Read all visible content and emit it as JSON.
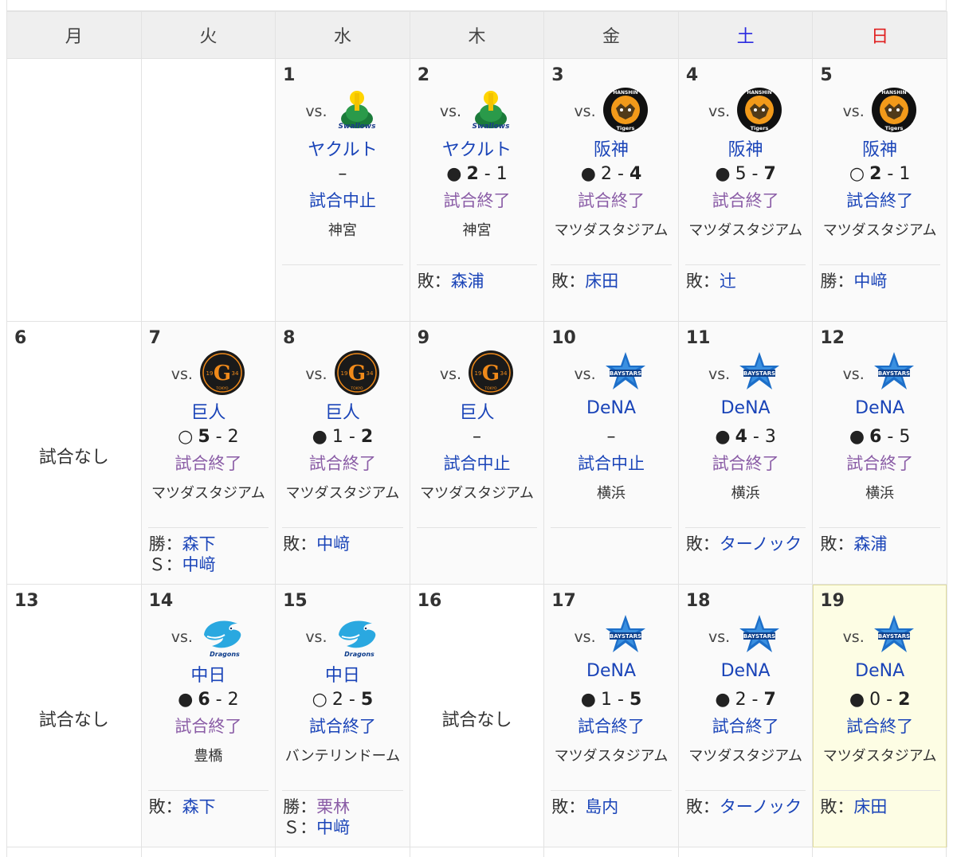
{
  "weekdays": [
    "月",
    "火",
    "水",
    "木",
    "金",
    "土",
    "日"
  ],
  "vs_label": "vs.",
  "no_game": "試合なし",
  "weeks": [
    [
      {
        "empty": true
      },
      {
        "empty": true
      },
      {
        "day": "1",
        "team": "ヤクルト",
        "logo": "swallows",
        "result": "",
        "score_l": "",
        "score_r": "",
        "bold": "",
        "dash": "–",
        "status": "試合中止",
        "status_kind": "cancel",
        "venue": "神宮",
        "pitchers": []
      },
      {
        "day": "2",
        "team": "ヤクルト",
        "logo": "swallows",
        "result": "●",
        "score_l": "2",
        "score_r": "1",
        "bold": "l",
        "status": "試合終了",
        "status_kind": "done",
        "venue": "神宮",
        "pitchers": [
          {
            "role": "敗：",
            "name": "森浦",
            "visited": false
          }
        ]
      },
      {
        "day": "3",
        "team": "阪神",
        "logo": "tigers",
        "result": "●",
        "score_l": "2",
        "score_r": "4",
        "bold": "r",
        "status": "試合終了",
        "status_kind": "done",
        "venue": "マツダスタジアム",
        "pitchers": [
          {
            "role": "敗：",
            "name": "床田",
            "visited": false
          }
        ]
      },
      {
        "day": "4",
        "team": "阪神",
        "logo": "tigers",
        "result": "●",
        "score_l": "5",
        "score_r": "7",
        "bold": "r",
        "status": "試合終了",
        "status_kind": "done",
        "venue": "マツダスタジアム",
        "pitchers": [
          {
            "role": "敗：",
            "name": "辻",
            "visited": false
          }
        ]
      },
      {
        "day": "5",
        "team": "阪神",
        "logo": "tigers",
        "result": "○",
        "score_l": "2",
        "score_r": "1",
        "bold": "l",
        "status": "試合終了",
        "status_kind": "done-blue",
        "venue": "マツダスタジアム",
        "pitchers": [
          {
            "role": "勝：",
            "name": "中﨑",
            "visited": false
          }
        ]
      }
    ],
    [
      {
        "day": "6",
        "nogame": true
      },
      {
        "day": "7",
        "team": "巨人",
        "logo": "giants",
        "result": "○",
        "score_l": "5",
        "score_r": "2",
        "bold": "l",
        "status": "試合終了",
        "status_kind": "done",
        "venue": "マツダスタジアム",
        "pitchers": [
          {
            "role": "勝：",
            "name": "森下",
            "visited": false
          },
          {
            "role": "Ｓ：",
            "name": "中﨑",
            "visited": false
          }
        ]
      },
      {
        "day": "8",
        "team": "巨人",
        "logo": "giants",
        "result": "●",
        "score_l": "1",
        "score_r": "2",
        "bold": "r",
        "status": "試合終了",
        "status_kind": "done",
        "venue": "マツダスタジアム",
        "pitchers": [
          {
            "role": "敗：",
            "name": "中﨑",
            "visited": false
          }
        ]
      },
      {
        "day": "9",
        "team": "巨人",
        "logo": "giants",
        "result": "",
        "score_l": "",
        "score_r": "",
        "bold": "",
        "dash": "–",
        "status": "試合中止",
        "status_kind": "cancel",
        "venue": "マツダスタジアム",
        "pitchers": []
      },
      {
        "day": "10",
        "team": "DeNA",
        "logo": "baystars",
        "result": "",
        "score_l": "",
        "score_r": "",
        "bold": "",
        "dash": "–",
        "status": "試合中止",
        "status_kind": "cancel",
        "venue": "横浜",
        "pitchers": []
      },
      {
        "day": "11",
        "team": "DeNA",
        "logo": "baystars",
        "result": "●",
        "score_l": "4",
        "score_r": "3",
        "bold": "l",
        "status": "試合終了",
        "status_kind": "done",
        "venue": "横浜",
        "pitchers": [
          {
            "role": "敗：",
            "name": "ターノック",
            "visited": false
          }
        ]
      },
      {
        "day": "12",
        "team": "DeNA",
        "logo": "baystars",
        "result": "●",
        "score_l": "6",
        "score_r": "5",
        "bold": "l",
        "status": "試合終了",
        "status_kind": "done",
        "venue": "横浜",
        "pitchers": [
          {
            "role": "敗：",
            "name": "森浦",
            "visited": false
          }
        ]
      }
    ],
    [
      {
        "day": "13",
        "nogame": true
      },
      {
        "day": "14",
        "team": "中日",
        "logo": "dragons",
        "result": "●",
        "score_l": "6",
        "score_r": "2",
        "bold": "l",
        "status": "試合終了",
        "status_kind": "done",
        "venue": "豊橋",
        "pitchers": [
          {
            "role": "敗：",
            "name": "森下",
            "visited": false
          }
        ]
      },
      {
        "day": "15",
        "team": "中日",
        "logo": "dragons",
        "result": "○",
        "score_l": "2",
        "score_r": "5",
        "bold": "r",
        "status": "試合終了",
        "status_kind": "done-blue",
        "venue": "バンテリンドーム",
        "pitchers": [
          {
            "role": "勝：",
            "name": "栗林",
            "visited": true
          },
          {
            "role": "Ｓ：",
            "name": "中﨑",
            "visited": false
          }
        ]
      },
      {
        "day": "16",
        "nogame": true
      },
      {
        "day": "17",
        "team": "DeNA",
        "logo": "baystars",
        "result": "●",
        "score_l": "1",
        "score_r": "5",
        "bold": "r",
        "status": "試合終了",
        "status_kind": "done-blue",
        "venue": "マツダスタジアム",
        "pitchers": [
          {
            "role": "敗：",
            "name": "島内",
            "visited": false
          }
        ]
      },
      {
        "day": "18",
        "team": "DeNA",
        "logo": "baystars",
        "result": "●",
        "score_l": "2",
        "score_r": "7",
        "bold": "r",
        "status": "試合終了",
        "status_kind": "done-blue",
        "venue": "マツダスタジアム",
        "pitchers": [
          {
            "role": "敗：",
            "name": "ターノック",
            "visited": false
          }
        ]
      },
      {
        "day": "19",
        "today": true,
        "team": "DeNA",
        "logo": "baystars",
        "result": "●",
        "score_l": "0",
        "score_r": "2",
        "bold": "r",
        "status": "試合終了",
        "status_kind": "done-blue",
        "venue": "マツダスタジアム",
        "pitchers": [
          {
            "role": "敗：",
            "name": "床田",
            "visited": false
          }
        ]
      }
    ]
  ],
  "colors": {
    "link": "#1a44b8",
    "visited": "#8a5ca6",
    "saturday": "#2a2ae0",
    "sunday": "#e02020",
    "today_bg": "#fdfde4"
  }
}
